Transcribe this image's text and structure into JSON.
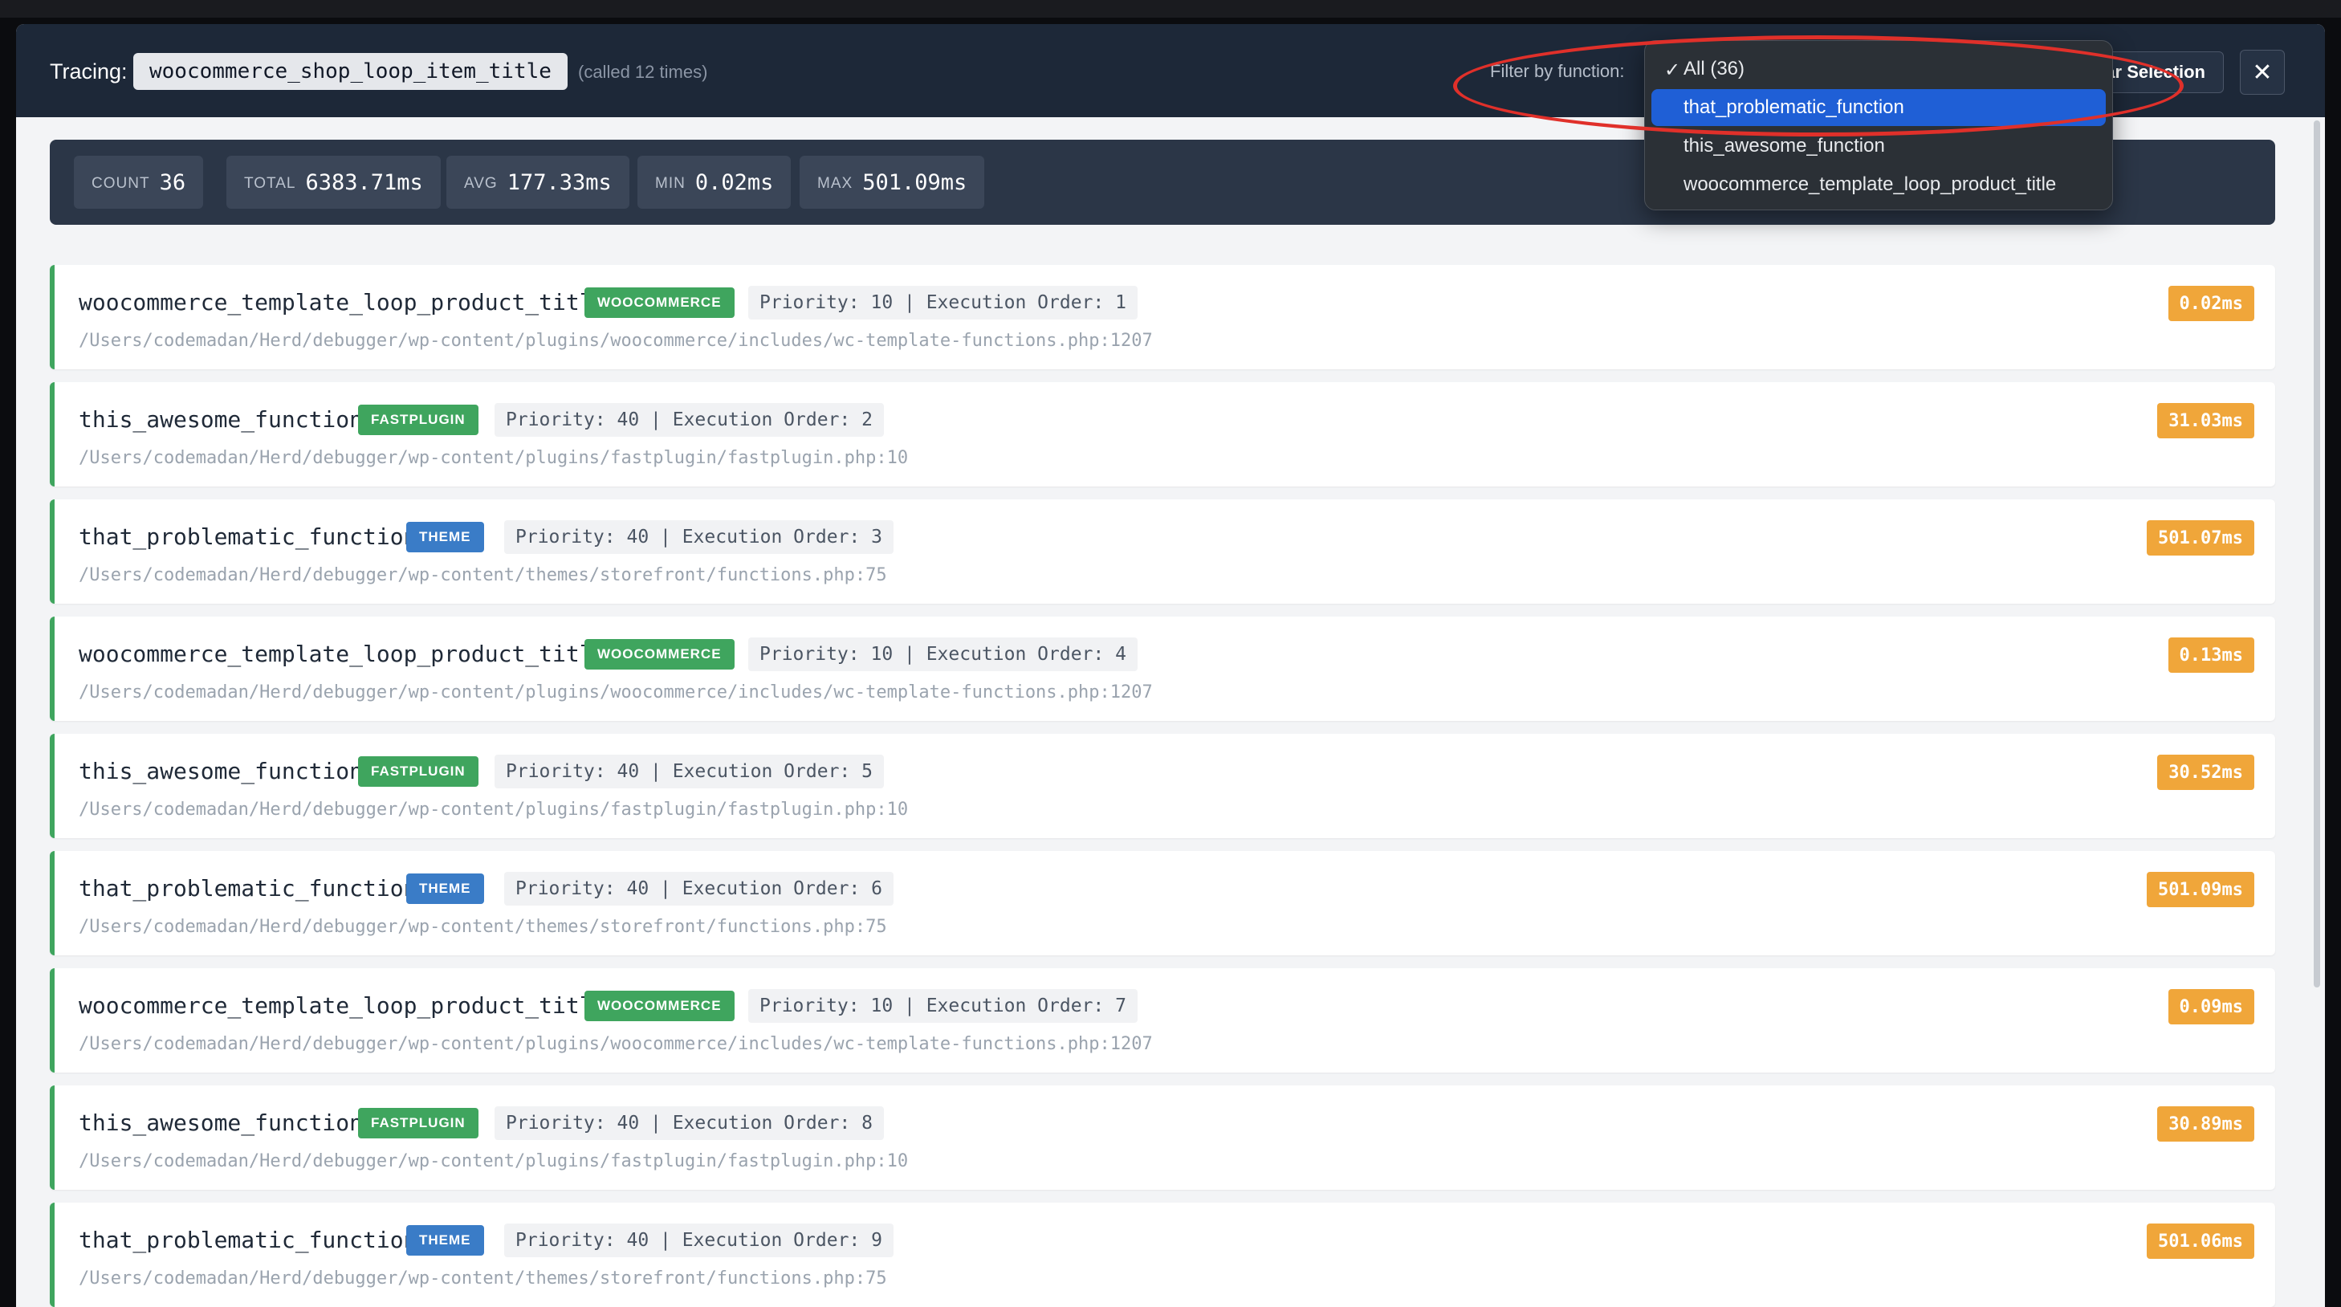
{
  "header": {
    "tracing_label": "Tracing:",
    "hook_name": "woocommerce_shop_loop_item_title",
    "called_text": "(called 12 times)",
    "filter_label": "Filter by function:",
    "clear_label": "ar Selection",
    "close_glyph": "✕"
  },
  "dropdown": {
    "options": [
      {
        "label": "All (36)",
        "checked": true
      },
      {
        "label": "that_problematic_function",
        "highlighted": true
      },
      {
        "label": "this_awesome_function"
      },
      {
        "label": "woocommerce_template_loop_product_title"
      }
    ],
    "check_glyph": "✓"
  },
  "stats": [
    {
      "label": "COUNT",
      "value": "36"
    },
    {
      "label": "TOTAL",
      "value": "6383.71ms"
    },
    {
      "label": "AVG",
      "value": "177.33ms"
    },
    {
      "label": "MIN",
      "value": "0.02ms"
    },
    {
      "label": "MAX",
      "value": "501.09ms"
    }
  ],
  "rows": [
    {
      "function": "woocommerce_template_loop_product_title",
      "tag": "WOOCOMMERCE",
      "meta": "Priority: 10 | Execution Order: 1",
      "path": "/Users/codemadan/Herd/debugger/wp-content/plugins/woocommerce/includes/wc-template-functions.php:1207",
      "time": "0.02ms"
    },
    {
      "function": "this_awesome_function",
      "tag": "FASTPLUGIN",
      "meta": "Priority: 40 | Execution Order: 2",
      "path": "/Users/codemadan/Herd/debugger/wp-content/plugins/fastplugin/fastplugin.php:10",
      "time": "31.03ms"
    },
    {
      "function": "that_problematic_function",
      "tag": "THEME",
      "meta": "Priority: 40 | Execution Order: 3",
      "path": "/Users/codemadan/Herd/debugger/wp-content/themes/storefront/functions.php:75",
      "time": "501.07ms"
    },
    {
      "function": "woocommerce_template_loop_product_title",
      "tag": "WOOCOMMERCE",
      "meta": "Priority: 10 | Execution Order: 4",
      "path": "/Users/codemadan/Herd/debugger/wp-content/plugins/woocommerce/includes/wc-template-functions.php:1207",
      "time": "0.13ms"
    },
    {
      "function": "this_awesome_function",
      "tag": "FASTPLUGIN",
      "meta": "Priority: 40 | Execution Order: 5",
      "path": "/Users/codemadan/Herd/debugger/wp-content/plugins/fastplugin/fastplugin.php:10",
      "time": "30.52ms"
    },
    {
      "function": "that_problematic_function",
      "tag": "THEME",
      "meta": "Priority: 40 | Execution Order: 6",
      "path": "/Users/codemadan/Herd/debugger/wp-content/themes/storefront/functions.php:75",
      "time": "501.09ms"
    },
    {
      "function": "woocommerce_template_loop_product_title",
      "tag": "WOOCOMMERCE",
      "meta": "Priority: 10 | Execution Order: 7",
      "path": "/Users/codemadan/Herd/debugger/wp-content/plugins/woocommerce/includes/wc-template-functions.php:1207",
      "time": "0.09ms"
    },
    {
      "function": "this_awesome_function",
      "tag": "FASTPLUGIN",
      "meta": "Priority: 40 | Execution Order: 8",
      "path": "/Users/codemadan/Herd/debugger/wp-content/plugins/fastplugin/fastplugin.php:10",
      "time": "30.89ms"
    },
    {
      "function": "that_problematic_function",
      "tag": "THEME",
      "meta": "Priority: 40 | Execution Order: 9",
      "path": "/Users/codemadan/Herd/debugger/wp-content/themes/storefront/functions.php:75",
      "time": "501.06ms"
    }
  ],
  "colors": {
    "header_bg": "#1d2838",
    "accent_green": "#3fa55e",
    "theme_blue": "#3a7cc7",
    "time_orange": "#f0a63a",
    "dropdown_highlight": "#1f5fd6",
    "annotation_red": "#e0302a"
  }
}
